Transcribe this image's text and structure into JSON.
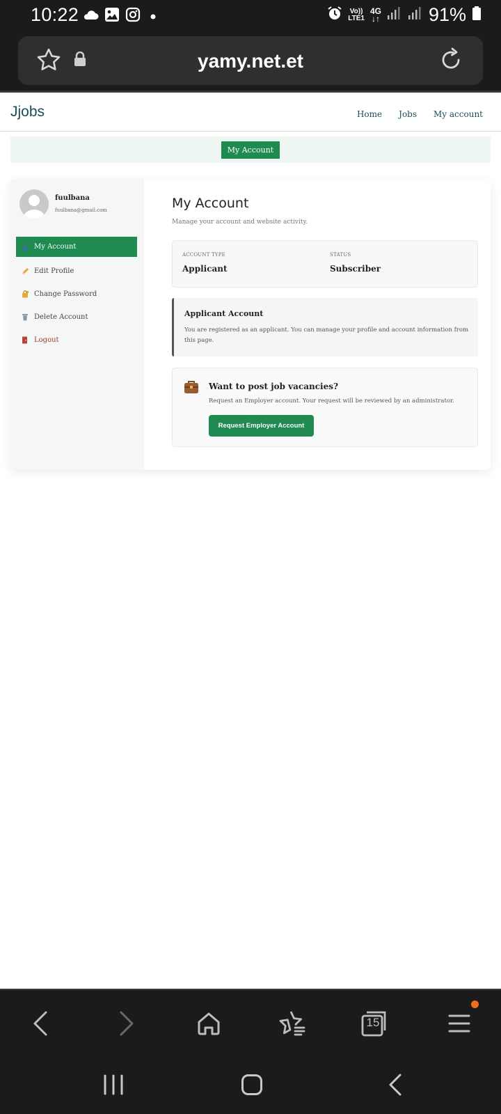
{
  "status_bar": {
    "time": "10:22",
    "battery": "91%",
    "network_top": "Vo))",
    "network_bottom": "LTE1",
    "data_type": "4G",
    "data_arrows": "↓↑"
  },
  "browser": {
    "url": "yamy.net.et",
    "tab_count": "15"
  },
  "site": {
    "brand": "Jjobs",
    "nav": [
      "Home",
      "Jobs",
      "My account"
    ]
  },
  "breadcrumb": {
    "label": "My Account"
  },
  "profile": {
    "name": "fuulbana",
    "email": "fuulbana@gmail.com"
  },
  "sidebar": {
    "items": [
      {
        "label": "My Account",
        "icon": "user-icon"
      },
      {
        "label": "Edit Profile",
        "icon": "pencil-icon"
      },
      {
        "label": "Change Password",
        "icon": "lock-key-icon"
      },
      {
        "label": "Delete Account",
        "icon": "trash-icon"
      },
      {
        "label": "Logout",
        "icon": "door-icon"
      }
    ]
  },
  "main": {
    "title": "My Account",
    "subtitle": "Manage your account and website activity.",
    "account_type_label": "ACCOUNT TYPE",
    "account_type_value": "Applicant",
    "status_label": "STATUS",
    "status_value": "Subscriber",
    "notice_title": "Applicant Account",
    "notice_text": "You are registered as an applicant. You can manage your profile and account information from this page.",
    "employer_title": "Want to post job vacancies?",
    "employer_text": "Request an Employer account. Your request will be reviewed by an administrator.",
    "employer_button": "Request Employer Account"
  },
  "colors": {
    "accent_green": "#1f8b50",
    "brand_teal": "#1a4d5c",
    "logout_red": "#a33d2c",
    "notification_dot": "#f26b1d"
  }
}
